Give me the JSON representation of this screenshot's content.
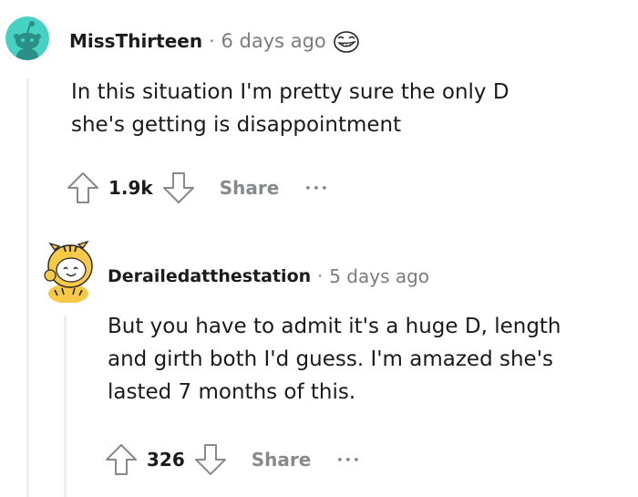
{
  "comments": [
    {
      "author": "MissThirteen",
      "separator": "·",
      "time": "6 days ago",
      "award_icon": "grinning-face-award-icon",
      "body_lines": [
        "In this situation I'm pretty sure the only D",
        "she's getting is disappointment"
      ],
      "score": "1.9k",
      "share_label": "Share",
      "more_label": "•••",
      "avatar_icon": "reddit-snoo-avatar-icon"
    },
    {
      "author": "Derailedatthestation",
      "separator": "·",
      "time": "5 days ago",
      "body_lines": [
        "But you have to admit it's a huge D, length",
        "and girth both I'd guess. I'm amazed she's",
        "lasted 7 months of this."
      ],
      "score": "326",
      "share_label": "Share",
      "more_label": "•••",
      "avatar_icon": "tiger-costume-snoo-avatar-icon"
    }
  ],
  "colors": {
    "text": "#1a1a1b",
    "muted": "#7c7c7c",
    "thread_line": "#edeff1",
    "avatar_teal": "#46d1c2"
  }
}
